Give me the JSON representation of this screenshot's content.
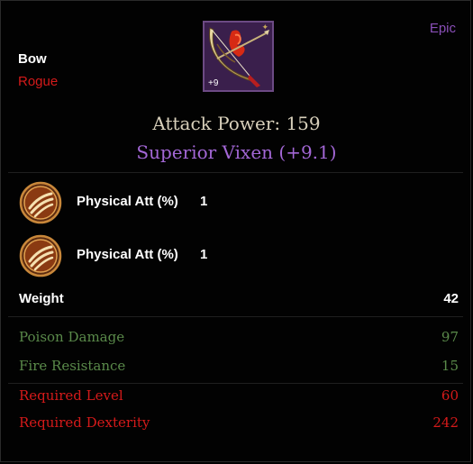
{
  "item": {
    "type": "Bow",
    "class": "Rogue",
    "rarity": "Epic",
    "enchant": "+9",
    "attack_power": "Attack Power: 159",
    "name": "Superior Vixen (+9.1)"
  },
  "stats": [
    {
      "icon": "physical-attack-claw-icon",
      "label": "Physical Att (%)",
      "value": "1"
    },
    {
      "icon": "physical-attack-claw-icon",
      "label": "Physical Att (%)",
      "value": "1"
    }
  ],
  "weight": {
    "label": "Weight",
    "value": "42"
  },
  "bonuses": [
    {
      "label": "Poison Damage",
      "value": "97"
    },
    {
      "label": "Fire Resistance",
      "value": "15"
    }
  ],
  "requirements": [
    {
      "label": "Required Level",
      "value": "60"
    },
    {
      "label": "Required Dexterity",
      "value": "242"
    }
  ],
  "colors": {
    "rarity_epic": "#8a4fb8",
    "name_purple": "#a367d6",
    "bonus_green": "#5a8a4a",
    "requirement_red": "#d41a1a"
  }
}
